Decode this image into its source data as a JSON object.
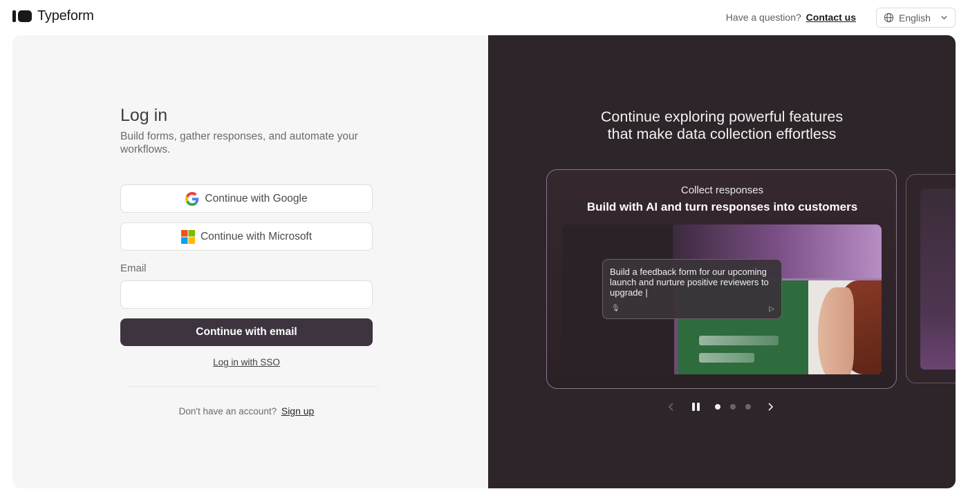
{
  "brand": {
    "name": "Typeform"
  },
  "header": {
    "help_text": "Have a question?",
    "contact_link": "Contact us",
    "language": "English"
  },
  "login": {
    "title": "Log in",
    "subtitle": "Build forms, gather responses, and automate your workflows.",
    "google_label": "Continue with Google",
    "microsoft_label": "Continue with Microsoft",
    "email_label": "Email",
    "email_value": "",
    "email_button": "Continue with email",
    "sso_link": "Log in with SSO",
    "signup_prompt": "Don't have an account?",
    "signup_link": "Sign up"
  },
  "promo": {
    "headline_line1": "Continue exploring powerful features",
    "headline_line2": "that make data collection effortless",
    "slides": [
      {
        "eyebrow": "Collect responses",
        "title": "Build with AI and turn responses into customers",
        "prompt_text": "Build a feedback form for our upcoming launch and nurture positive reviewers to upgrade |"
      }
    ],
    "carousel": {
      "slide_count": 3,
      "active_index": 0,
      "playing": true
    }
  },
  "colors": {
    "primary_button": "#3d3440",
    "promo_background": "#2d2529",
    "left_background": "#f6f6f6"
  },
  "icons": {
    "google": "google-logo-icon",
    "microsoft": "microsoft-logo-icon",
    "globe": "globe-icon",
    "chevron": "chevron-down-icon",
    "pause": "pause-icon",
    "prev": "chevron-left-icon",
    "next": "chevron-right-icon"
  }
}
